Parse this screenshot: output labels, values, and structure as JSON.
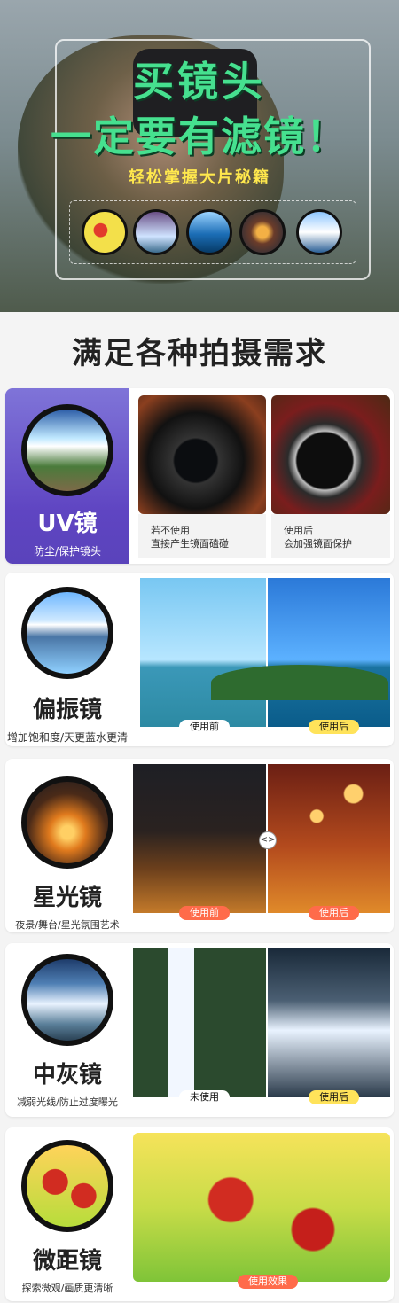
{
  "hero": {
    "title_line1": "买镜头",
    "title_line2": "一定要有滤镜！",
    "subtitle": "轻松掌握大片秘籍"
  },
  "section": {
    "title": "满足各种拍摄需求"
  },
  "cards": [
    {
      "name": "UV镜",
      "desc": "防尘/保护镜头",
      "left_caption": [
        "若不使用",
        "直接产生镜面磕碰"
      ],
      "right_caption": [
        "使用后",
        "会加强镜面保护"
      ]
    },
    {
      "name": "偏振镜",
      "desc": "增加饱和度/天更蓝水更清",
      "badge_left": "使用前",
      "badge_right": "使用后"
    },
    {
      "name": "星光镜",
      "desc": "夜景/舞台/星光氛围艺术",
      "badge_left": "使用前",
      "badge_right": "使用后",
      "compare_symbol": "<>"
    },
    {
      "name": "中灰镜",
      "desc": "减弱光线/防止过度曝光",
      "badge_left": "未使用",
      "badge_right": "使用后"
    },
    {
      "name": "微距镜",
      "desc": "探索微观/画质更清晰",
      "badge": "使用效果"
    }
  ]
}
